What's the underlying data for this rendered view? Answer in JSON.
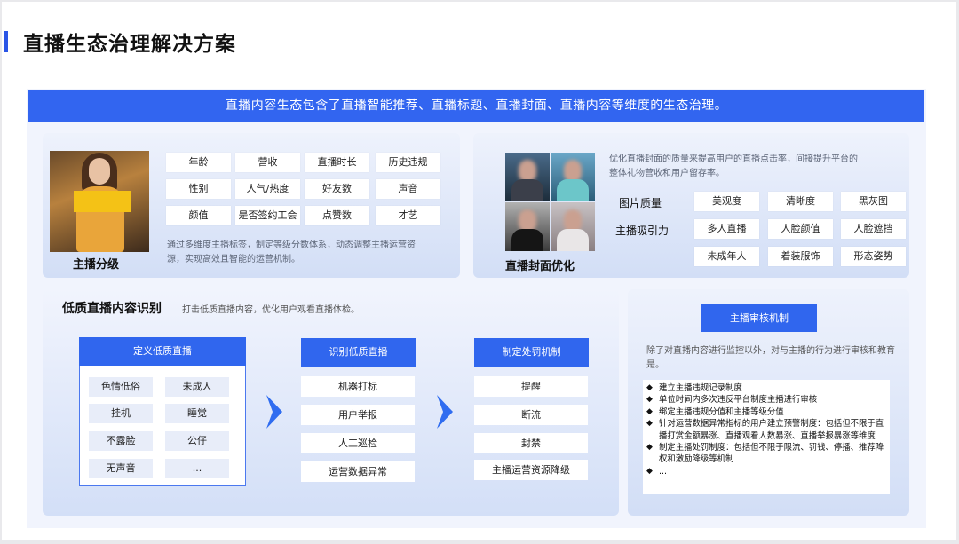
{
  "title": "直播生态治理解决方案",
  "banner": "直播内容生态包含了直播智能推荐、直播标题、直播封面、直播内容等维度的生态治理。",
  "grading": {
    "label": "主播分级",
    "tags": [
      [
        "年龄",
        "营收",
        "直播时长",
        "历史违规"
      ],
      [
        "性别",
        "人气/热度",
        "好友数",
        "声音"
      ],
      [
        "颜值",
        "是否签约工会",
        "点赞数",
        "才艺"
      ]
    ],
    "desc_line1": "通过多维度主播标签，制定等级分数体系，动态调整主播运营资",
    "desc_line2": "源，实现高效且智能的运营机制。"
  },
  "cover": {
    "label": "直播封面优化",
    "desc_line1": "优化直播封面的质量来提高用户的直播点击率，间接提升平台的",
    "desc_line2": "整体礼物营收和用户留存率。",
    "row_labels": [
      "图片质量",
      "主播吸引力"
    ],
    "tags": [
      [
        "美观度",
        "清晰度",
        "黑灰图"
      ],
      [
        "多人直播",
        "人脸颜值",
        "人脸遮挡"
      ],
      [
        "未成年人",
        "着装服饰",
        "形态姿势"
      ]
    ]
  },
  "low_quality": {
    "title": "低质直播内容识别",
    "subtitle": "打击低质直播内容，优化用户观看直播体检。",
    "define": {
      "head": "定义低质直播",
      "tags": [
        "色情低俗",
        "未成人",
        "挂机",
        "睡觉",
        "不露脸",
        "公仔",
        "无声音",
        "..."
      ]
    },
    "identify": {
      "head": "识别低质直播",
      "tags": [
        "机器打标",
        "用户举报",
        "人工巡检",
        "运营数据异常"
      ]
    },
    "punish": {
      "head": "制定处罚机制",
      "tags": [
        "提醒",
        "断流",
        "封禁",
        "主播运营资源降级"
      ]
    }
  },
  "review": {
    "button": "主播审核机制",
    "desc": "除了对直播内容进行监控以外，对与主播的行为进行审核和教育是。",
    "bullet": "◆",
    "items": [
      "建立主播违规记录制度",
      "单位时间内多次违反平台制度主播进行审核",
      "绑定主播违规分值和主播等级分值",
      "针对运营数据异常指标的用户建立预警制度：包括但不限于直播打赏金额暴涨、直播观看人数暴涨、直播举报暴涨等维度",
      "制定主播处罚制度：包括但不限于限流、罚钱、停播、推荐降权和激励降级等机制",
      "..."
    ]
  },
  "colors": {
    "accent": "#3066ee",
    "banner": "#3265f0",
    "highlight_mask": "#f4c216"
  }
}
